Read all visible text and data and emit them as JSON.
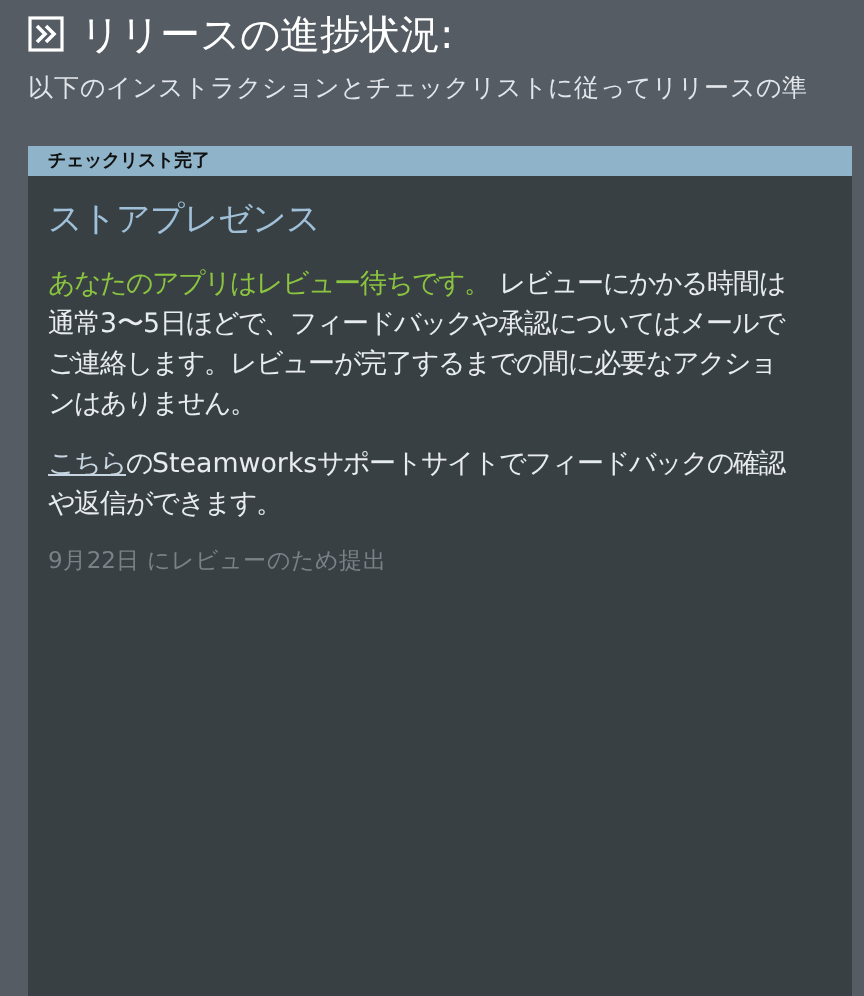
{
  "page_title": "リリースの進捗状況:",
  "subtitle": "以下のインストラクションとチェックリストに従ってリリースの準",
  "panel": {
    "header": "チェックリスト完了",
    "title": "ストアプレゼンス",
    "status_text": "あなたのアプリはレビュー待ちです。",
    "detail_text": "レビューにかかる時間は通常3〜5日ほどで、フィードバックや承認についてはメールでご連絡します。レビューが完了するまでの間に必要なアクションはありません。",
    "link": "こちら",
    "link_text": "のSteamworksサポートサイトでフィードバックの確認や返信ができます。",
    "submitted": "9月22日 にレビューのため提出"
  }
}
